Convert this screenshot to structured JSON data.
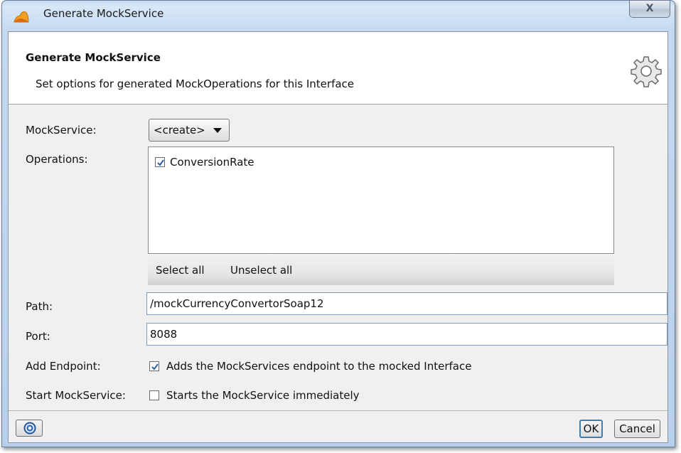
{
  "window": {
    "title": "Generate MockService",
    "close_label": "X"
  },
  "banner": {
    "title": "Generate MockService",
    "description": "Set options for generated MockOperations for this Interface"
  },
  "form": {
    "mockservice": {
      "label": "MockService:",
      "selected": "<create>"
    },
    "operations": {
      "label": "Operations:",
      "items": [
        {
          "label": "ConversionRate",
          "checked": true
        }
      ],
      "select_all": "Select all",
      "unselect_all": "Unselect all"
    },
    "path": {
      "label": "Path:",
      "value": "/mockCurrencyConvertorSoap12"
    },
    "port": {
      "label": "Port:",
      "value": "8088"
    },
    "add_endpoint": {
      "label": "Add Endpoint:",
      "checked": true,
      "text": "Adds the MockServices endpoint to the mocked Interface"
    },
    "start_mockservice": {
      "label": "Start MockService:",
      "checked": false,
      "text": "Starts the MockService immediately"
    }
  },
  "buttons": {
    "ok": "OK",
    "cancel": "Cancel"
  },
  "icons": {
    "app": "soapui-logo-icon",
    "settings": "gear-icon",
    "help": "help-icon"
  }
}
